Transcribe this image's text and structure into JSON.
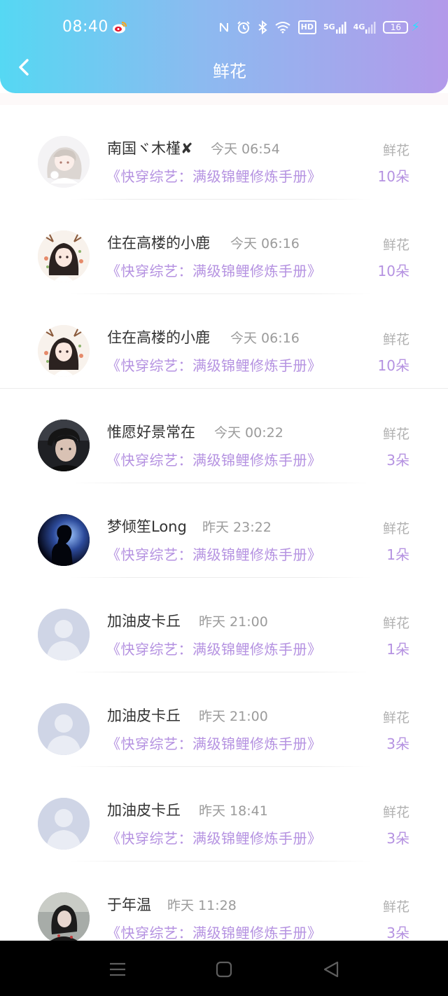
{
  "status_bar": {
    "time": "08:40",
    "hd_badge": "HD",
    "net1": "5G",
    "net2": "4G",
    "battery": "16",
    "icons": [
      "weibo-icon",
      "nfc-icon",
      "alarm-icon",
      "bluetooth-icon",
      "wifi-icon",
      "signal-icon",
      "battery-icon",
      "charging-icon"
    ]
  },
  "header": {
    "title": "鲜花",
    "back_icon": "chevron-left-icon"
  },
  "colors": {
    "header_gradient": [
      "#55d8f3",
      "#8cbaf0",
      "#b39aea"
    ],
    "accent": "#b592e1",
    "name_text": "#333333",
    "muted_text": "#9b9b9b"
  },
  "records": [
    {
      "name": "南国ヾ木槿✘",
      "time": "今天 06:54",
      "book": "《快穿综艺：满级锦鲤修炼手册》",
      "gift": "鲜花",
      "count": "10朵",
      "avatar": "anime-girl-avatar"
    },
    {
      "name": "住在高楼的小鹿",
      "time": "今天 06:16",
      "book": "《快穿综艺：满级锦鲤修炼手册》",
      "gift": "鲜花",
      "count": "10朵",
      "avatar": "deer-girl-avatar"
    },
    {
      "name": "住在高楼的小鹿",
      "time": "今天 06:16",
      "book": "《快穿综艺：满级锦鲤修炼手册》",
      "gift": "鲜花",
      "count": "10朵",
      "avatar": "deer-girl-avatar"
    },
    {
      "name": "惟愿好景常在",
      "time": "今天 00:22",
      "book": "《快穿综艺：满级锦鲤修炼手册》",
      "gift": "鲜花",
      "count": "3朵",
      "avatar": "young-man-avatar"
    },
    {
      "name": "梦倾笙Long",
      "time": "昨天 23:22",
      "book": "《快穿综艺：满级锦鲤修炼手册》",
      "gift": "鲜花",
      "count": "1朵",
      "avatar": "silhouette-avatar"
    },
    {
      "name": "加油皮卡丘",
      "time": "昨天 21:00",
      "book": "《快穿综艺：满级锦鲤修炼手册》",
      "gift": "鲜花",
      "count": "1朵",
      "avatar": "default-avatar"
    },
    {
      "name": "加油皮卡丘",
      "time": "昨天 21:00",
      "book": "《快穿综艺：满级锦鲤修炼手册》",
      "gift": "鲜花",
      "count": "3朵",
      "avatar": "default-avatar"
    },
    {
      "name": "加油皮卡丘",
      "time": "昨天 18:41",
      "book": "《快穿综艺：满级锦鲤修炼手册》",
      "gift": "鲜花",
      "count": "3朵",
      "avatar": "default-avatar"
    },
    {
      "name": "于年温",
      "time": "昨天 11:28",
      "book": "《快穿综艺：满级锦鲤修炼手册》",
      "gift": "鲜花",
      "count": "3朵",
      "avatar": "girl-photo-avatar"
    }
  ],
  "nav_bar": {
    "icons": [
      "menu-icon",
      "home-icon",
      "back-triangle-icon"
    ]
  }
}
